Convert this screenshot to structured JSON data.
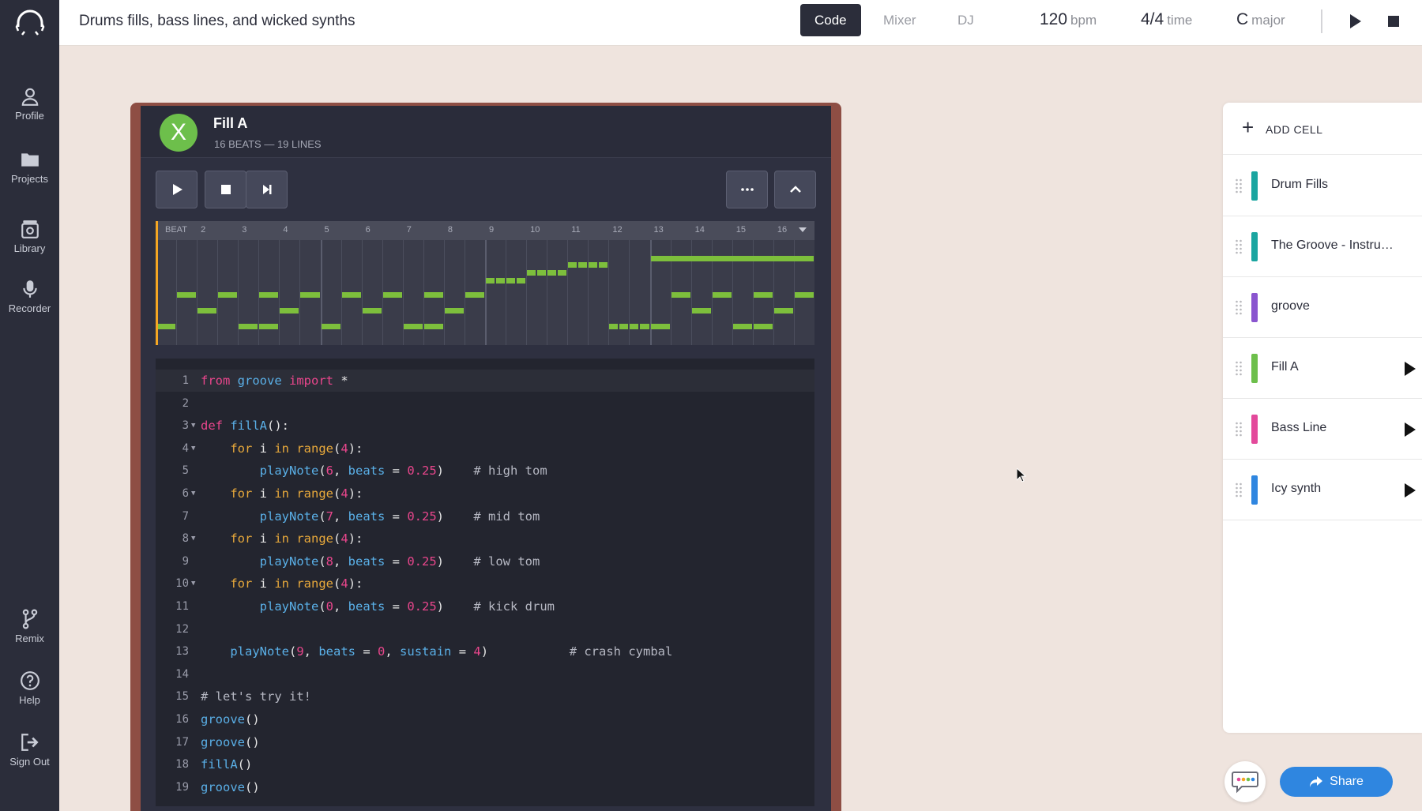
{
  "app": {
    "project_title": "Drums fills, bass lines, and wicked synths"
  },
  "topbar": {
    "tabs": [
      {
        "label": "Code",
        "active": true
      },
      {
        "label": "Mixer",
        "active": false
      },
      {
        "label": "DJ",
        "active": false
      }
    ],
    "bpm_value": "120",
    "bpm_unit": "bpm",
    "time_value": "4/4",
    "time_unit": "time",
    "key_value": "C",
    "key_unit": "major"
  },
  "sidebar": {
    "items": [
      {
        "label": "Profile",
        "icon": "user-icon"
      },
      {
        "label": "Projects",
        "icon": "folder-icon"
      },
      {
        "label": "Library",
        "icon": "library-icon"
      },
      {
        "label": "Recorder",
        "icon": "microphone-icon"
      },
      {
        "label": "Remix",
        "icon": "branch-icon"
      },
      {
        "label": "Help",
        "icon": "help-icon"
      },
      {
        "label": "Sign Out",
        "icon": "sign-out-icon"
      }
    ]
  },
  "cell": {
    "avatar_letter": "X",
    "title": "Fill A",
    "subtitle": "16 BEATS — 19 LINES",
    "beat_labels": [
      "BEAT",
      "2",
      "3",
      "4",
      "5",
      "6",
      "7",
      "8",
      "9",
      "10",
      "11",
      "12",
      "13",
      "14",
      "15",
      "16"
    ]
  },
  "code": {
    "lines": [
      "from groove import *",
      "",
      "def fillA():",
      "    for i in range(4):",
      "        playNote(6, beats = 0.25)    # high tom",
      "    for i in range(4):",
      "        playNote(7, beats = 0.25)    # mid tom",
      "    for i in range(4):",
      "        playNote(8, beats = 0.25)    # low tom",
      "    for i in range(4):",
      "        playNote(0, beats = 0.25)    # kick drum",
      "",
      "    playNote(9, beats = 0, sustain = 4)           # crash cymbal",
      "",
      "# let's try it!",
      "groove()",
      "groove()",
      "fillA()",
      "groove()"
    ]
  },
  "right_panel": {
    "add_cell_label": "ADD CELL",
    "tracks": [
      {
        "name": "Drum Fills",
        "color": "#1aa5a0",
        "playable": false
      },
      {
        "name": "The Groove - Instructions",
        "color": "#1aa5a0",
        "playable": false
      },
      {
        "name": "groove",
        "color": "#8a55cf",
        "playable": false
      },
      {
        "name": "Fill A",
        "color": "#6dbf4b",
        "playable": true
      },
      {
        "name": "Bass Line",
        "color": "#e3499b",
        "playable": true
      },
      {
        "name": "Icy synth",
        "color": "#2f86e0",
        "playable": true
      }
    ]
  },
  "actions": {
    "share_label": "Share"
  },
  "colors": {
    "accent": "#2f86e0",
    "note_green": "#7dbf3c",
    "sidebar_bg": "#2b2d3a"
  }
}
